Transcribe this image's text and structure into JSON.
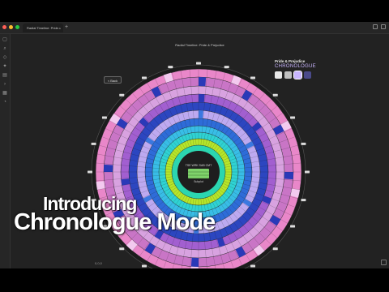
{
  "window": {
    "tab_title": "Radial Timeline: Pride...",
    "tab_close": "×",
    "new_tab": "+",
    "traffic_light_colors": [
      "#ff5f57",
      "#febc2e",
      "#28c840"
    ]
  },
  "document": {
    "title": "Radial Timeline: Pride & Prejudice",
    "badge": "< Back"
  },
  "plugin_panel": {
    "title": "Pride & Prejudice",
    "mode": "CHRONOLOGUE",
    "swatches": [
      {
        "name": "swatch-1",
        "color": "#e8e8e8"
      },
      {
        "name": "swatch-2",
        "color": "#bfbfbf"
      },
      {
        "name": "swatch-3",
        "color": "#c9b6ff",
        "selected": true
      },
      {
        "name": "swatch-4",
        "color": "#4a4a8a"
      }
    ]
  },
  "wheel": {
    "center_text": [
      "TSE  WRK  SAB  CMT",
      "Subplot"
    ],
    "ring_colors": [
      "#e987c9",
      "#c975c6",
      "#d8a2e0",
      "#a25fd0",
      "#2c46c0",
      "#bda9f0",
      "#2e6cd8",
      "#38bde6",
      "#2fd2d2",
      "#b6e52a",
      "#2bd6b0"
    ],
    "accent_block_color": "#2a39b8",
    "pale_block_color": "#f3c9ef"
  },
  "overlay": {
    "line1": "Introducing",
    "line2": "Chronologue Mode"
  },
  "status": {
    "coords": "0,0,0"
  }
}
